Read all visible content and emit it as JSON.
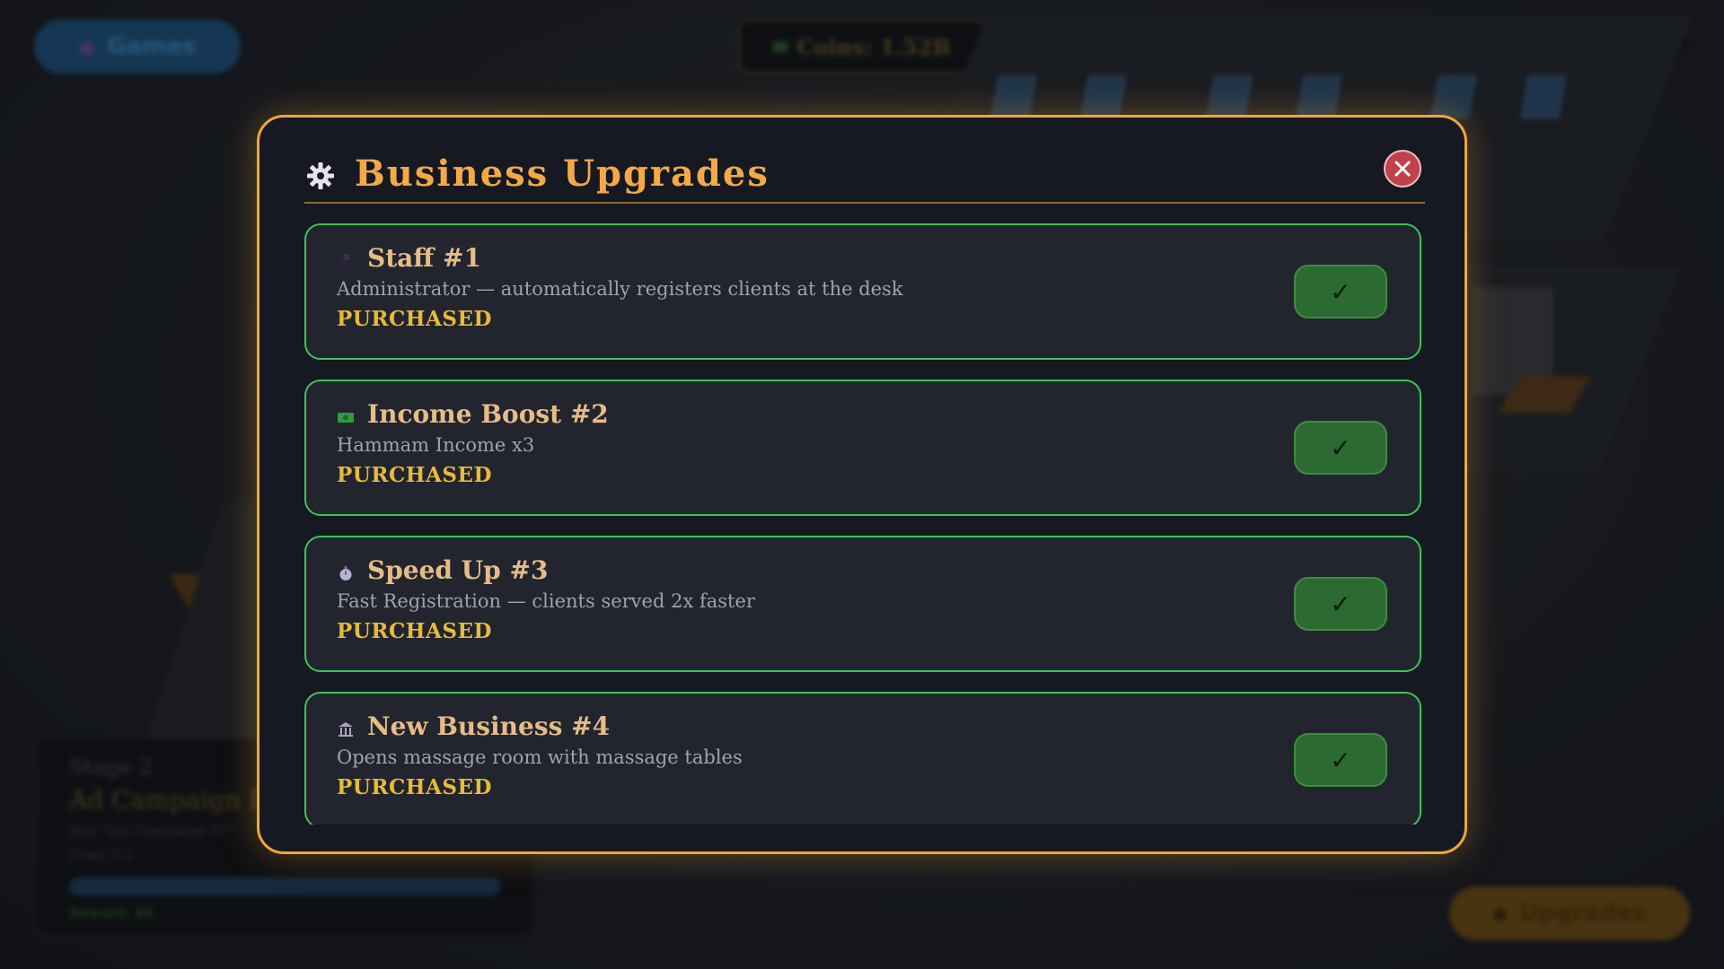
{
  "hud": {
    "games_label": "Games",
    "coins_label": "Coins: 1.52B",
    "upgrades_label": "Upgrades"
  },
  "stage_panel": {
    "stage": "Stage 2",
    "title": "Ad Campaign IV",
    "task": "Buy \"Ad Campaign IV\"",
    "goal": "Goal: 1/1",
    "reward": "Reward: 4K"
  },
  "modal": {
    "title": "Business Upgrades",
    "accent_color": "#f0a63a",
    "items": [
      {
        "icon": "person-icon",
        "title": "Staff #1",
        "description": "Administrator — automatically registers clients at the desk",
        "status": "PURCHASED",
        "button": "✓"
      },
      {
        "icon": "money-icon",
        "title": "Income Boost #2",
        "description": "Hammam Income x3",
        "status": "PURCHASED",
        "button": "✓"
      },
      {
        "icon": "stopwatch-icon",
        "title": "Speed Up #3",
        "description": "Fast Registration — clients served 2x faster",
        "status": "PURCHASED",
        "button": "✓"
      },
      {
        "icon": "building-icon",
        "title": "New Business #4",
        "description": "Opens massage room with massage tables",
        "status": "PURCHASED",
        "button": "✓"
      }
    ]
  }
}
